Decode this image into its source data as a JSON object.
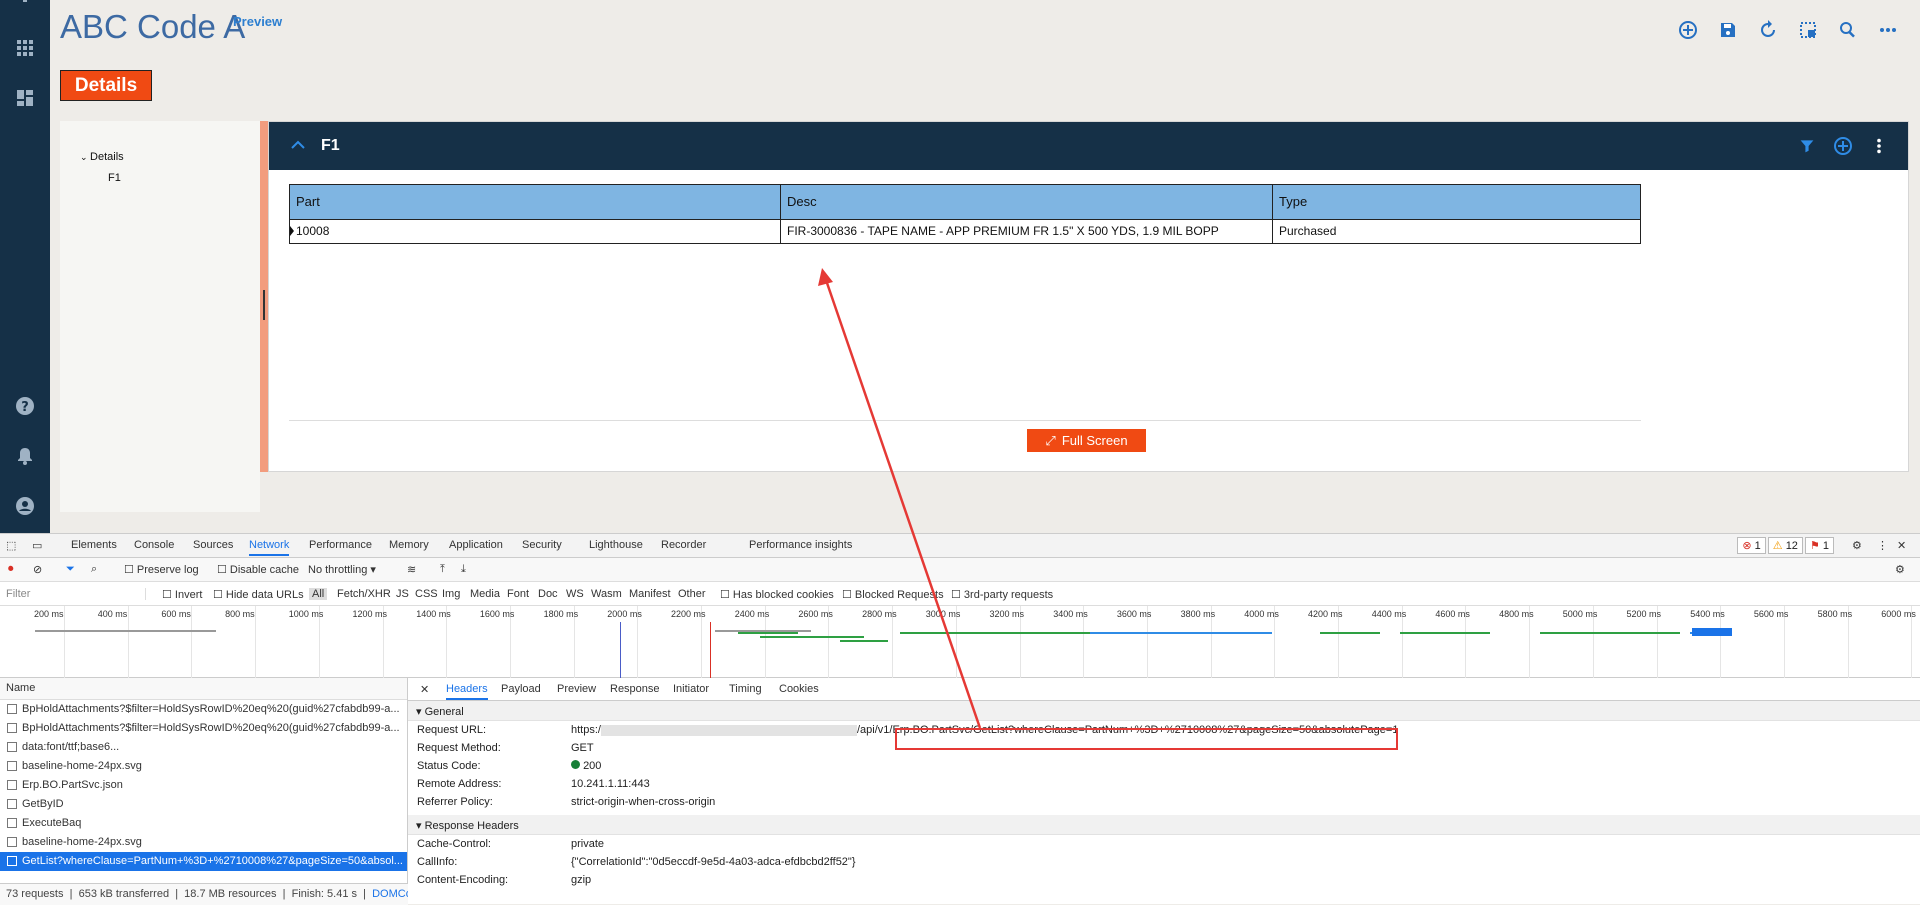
{
  "app": {
    "title": "ABC Code A",
    "preview_label": "Preview",
    "details_button": "Details",
    "tree": {
      "root": "Details",
      "child": "F1"
    },
    "panel": {
      "title": "F1",
      "columns": [
        "Part",
        "Desc",
        "Type"
      ],
      "rows": [
        {
          "part": "10008",
          "desc": "FIR-3000836 - TAPE NAME - APP PREMIUM FR 1.5\" X 500 YDS, 1.9 MIL BOPP",
          "type": "Purchased"
        }
      ],
      "fullscreen_label": "Full Screen"
    },
    "icons": {
      "rail": [
        "menu-icon",
        "apps-grid-icon",
        "dashboard-icon",
        "help-icon",
        "bell-icon",
        "account-icon"
      ],
      "toolbar": [
        "add-icon",
        "save-icon",
        "refresh-icon",
        "layout-icon",
        "search-icon",
        "more-icon"
      ]
    },
    "colors": {
      "rail": "#153047",
      "accent": "#f04a13",
      "header_blue": "#7fb5e2",
      "link": "#2670c2"
    }
  },
  "devtools": {
    "tabs": [
      "Elements",
      "Console",
      "Sources",
      "Network",
      "Performance",
      "Memory",
      "Application",
      "Security",
      "Lighthouse",
      "Recorder",
      "Performance insights"
    ],
    "active_tab": "Network",
    "badges": {
      "errors": "1",
      "warnings": "12",
      "issues": "1"
    },
    "toolbar": {
      "preserve_log": "Preserve log",
      "disable_cache": "Disable cache",
      "throttling": "No throttling"
    },
    "filter": {
      "placeholder": "Filter",
      "invert": "Invert",
      "hide_data_urls": "Hide data URLs",
      "types": [
        "All",
        "Fetch/XHR",
        "JS",
        "CSS",
        "Img",
        "Media",
        "Font",
        "Doc",
        "WS",
        "Wasm",
        "Manifest",
        "Other"
      ],
      "has_blocked_cookies": "Has blocked cookies",
      "blocked_requests": "Blocked Requests",
      "third_party": "3rd-party requests"
    },
    "timeline_labels": [
      "200 ms",
      "400 ms",
      "600 ms",
      "800 ms",
      "1000 ms",
      "1200 ms",
      "1400 ms",
      "1600 ms",
      "1800 ms",
      "2000 ms",
      "2200 ms",
      "2400 ms",
      "2600 ms",
      "2800 ms",
      "3000 ms",
      "3200 ms",
      "3400 ms",
      "3600 ms",
      "3800 ms",
      "4000 ms",
      "4200 ms",
      "4400 ms",
      "4600 ms",
      "4800 ms",
      "5000 ms",
      "5200 ms",
      "5400 ms",
      "5600 ms",
      "5800 ms",
      "6000 ms"
    ],
    "names_header": "Name",
    "requests": [
      "BpHoldAttachments?$filter=HoldSysRowID%20eq%20(guid%27cfabdb99-a...",
      "BpHoldAttachments?$filter=HoldSysRowID%20eq%20(guid%27cfabdb99-a...",
      "data:font/ttf;base6...",
      "baseline-home-24px.svg",
      "Erp.BO.PartSvc.json",
      "GetByID",
      "ExecuteBaq",
      "baseline-home-24px.svg",
      "GetList?whereClause=PartNum+%3D+%2710008%27&pageSize=50&absol..."
    ],
    "selected_index": 8,
    "status": {
      "requests": "73 requests",
      "transferred": "653 kB transferred",
      "resources": "18.7 MB resources",
      "finish": "Finish: 5.41 s",
      "dom": "DOMCo"
    },
    "detail_tabs": [
      "Headers",
      "Payload",
      "Preview",
      "Response",
      "Initiator",
      "Timing",
      "Cookies"
    ],
    "general_label": "General",
    "general": [
      {
        "k": "Request URL:",
        "v": "https:/"
      },
      {
        "k": "Request Method:",
        "v": "GET"
      },
      {
        "k": "Status Code:",
        "v": "200"
      },
      {
        "k": "Remote Address:",
        "v": "10.241.1.11:443"
      },
      {
        "k": "Referrer Policy:",
        "v": "strict-origin-when-cross-origin"
      }
    ],
    "url_mid": "/api/v1/",
    "url_tail": "Erp.BO.PartSvc/GetList?whereClause=PartNum+%3D+%2710008%27&pageSize=50&absolutePage=1",
    "response_label": "Response Headers",
    "response": [
      {
        "k": "Cache-Control:",
        "v": "private"
      },
      {
        "k": "CallInfo:",
        "v": "{\"CorrelationId\":\"0d5eccdf-9e5d-4a03-adca-efdbcbd2ff52\"}"
      },
      {
        "k": "Content-Encoding:",
        "v": "gzip"
      }
    ]
  }
}
